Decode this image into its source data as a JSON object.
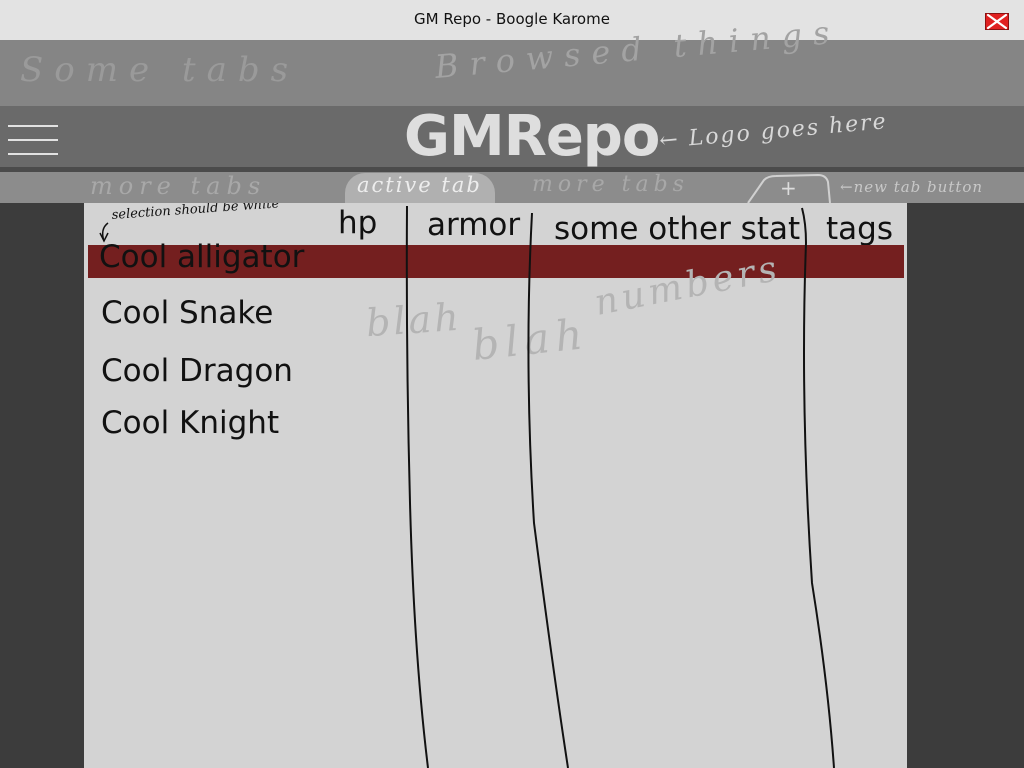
{
  "window": {
    "title": "GM Repo - Boogle Karome",
    "close_icon": "close-x-icon",
    "close_color": "#e02020"
  },
  "browser_tabs": {
    "left_note": "Some tabs",
    "center_note": "Browsed things"
  },
  "header": {
    "menu_icon": "hamburger-menu-icon",
    "logo": "GMRepo",
    "logo_note": "← Logo goes here"
  },
  "tabs": {
    "items": [
      {
        "label": "more tabs",
        "active": false
      },
      {
        "label": "active tab",
        "active": true
      },
      {
        "label": "more tabs",
        "active": false
      }
    ],
    "new_tab_label": "+",
    "new_tab_note": "←new tab button"
  },
  "table": {
    "selection_note": "selection should be white",
    "columns": [
      "hp",
      "armor",
      "some other stat",
      "tags"
    ],
    "rows": [
      {
        "name": "Cool alligator",
        "selected": true
      },
      {
        "name": "Cool Snake",
        "selected": false
      },
      {
        "name": "Cool Dragon",
        "selected": false
      },
      {
        "name": "Cool Knight",
        "selected": false
      }
    ],
    "scribbles": [
      "blah",
      "blah",
      "numbers"
    ],
    "selection_color": "#741f1f"
  }
}
